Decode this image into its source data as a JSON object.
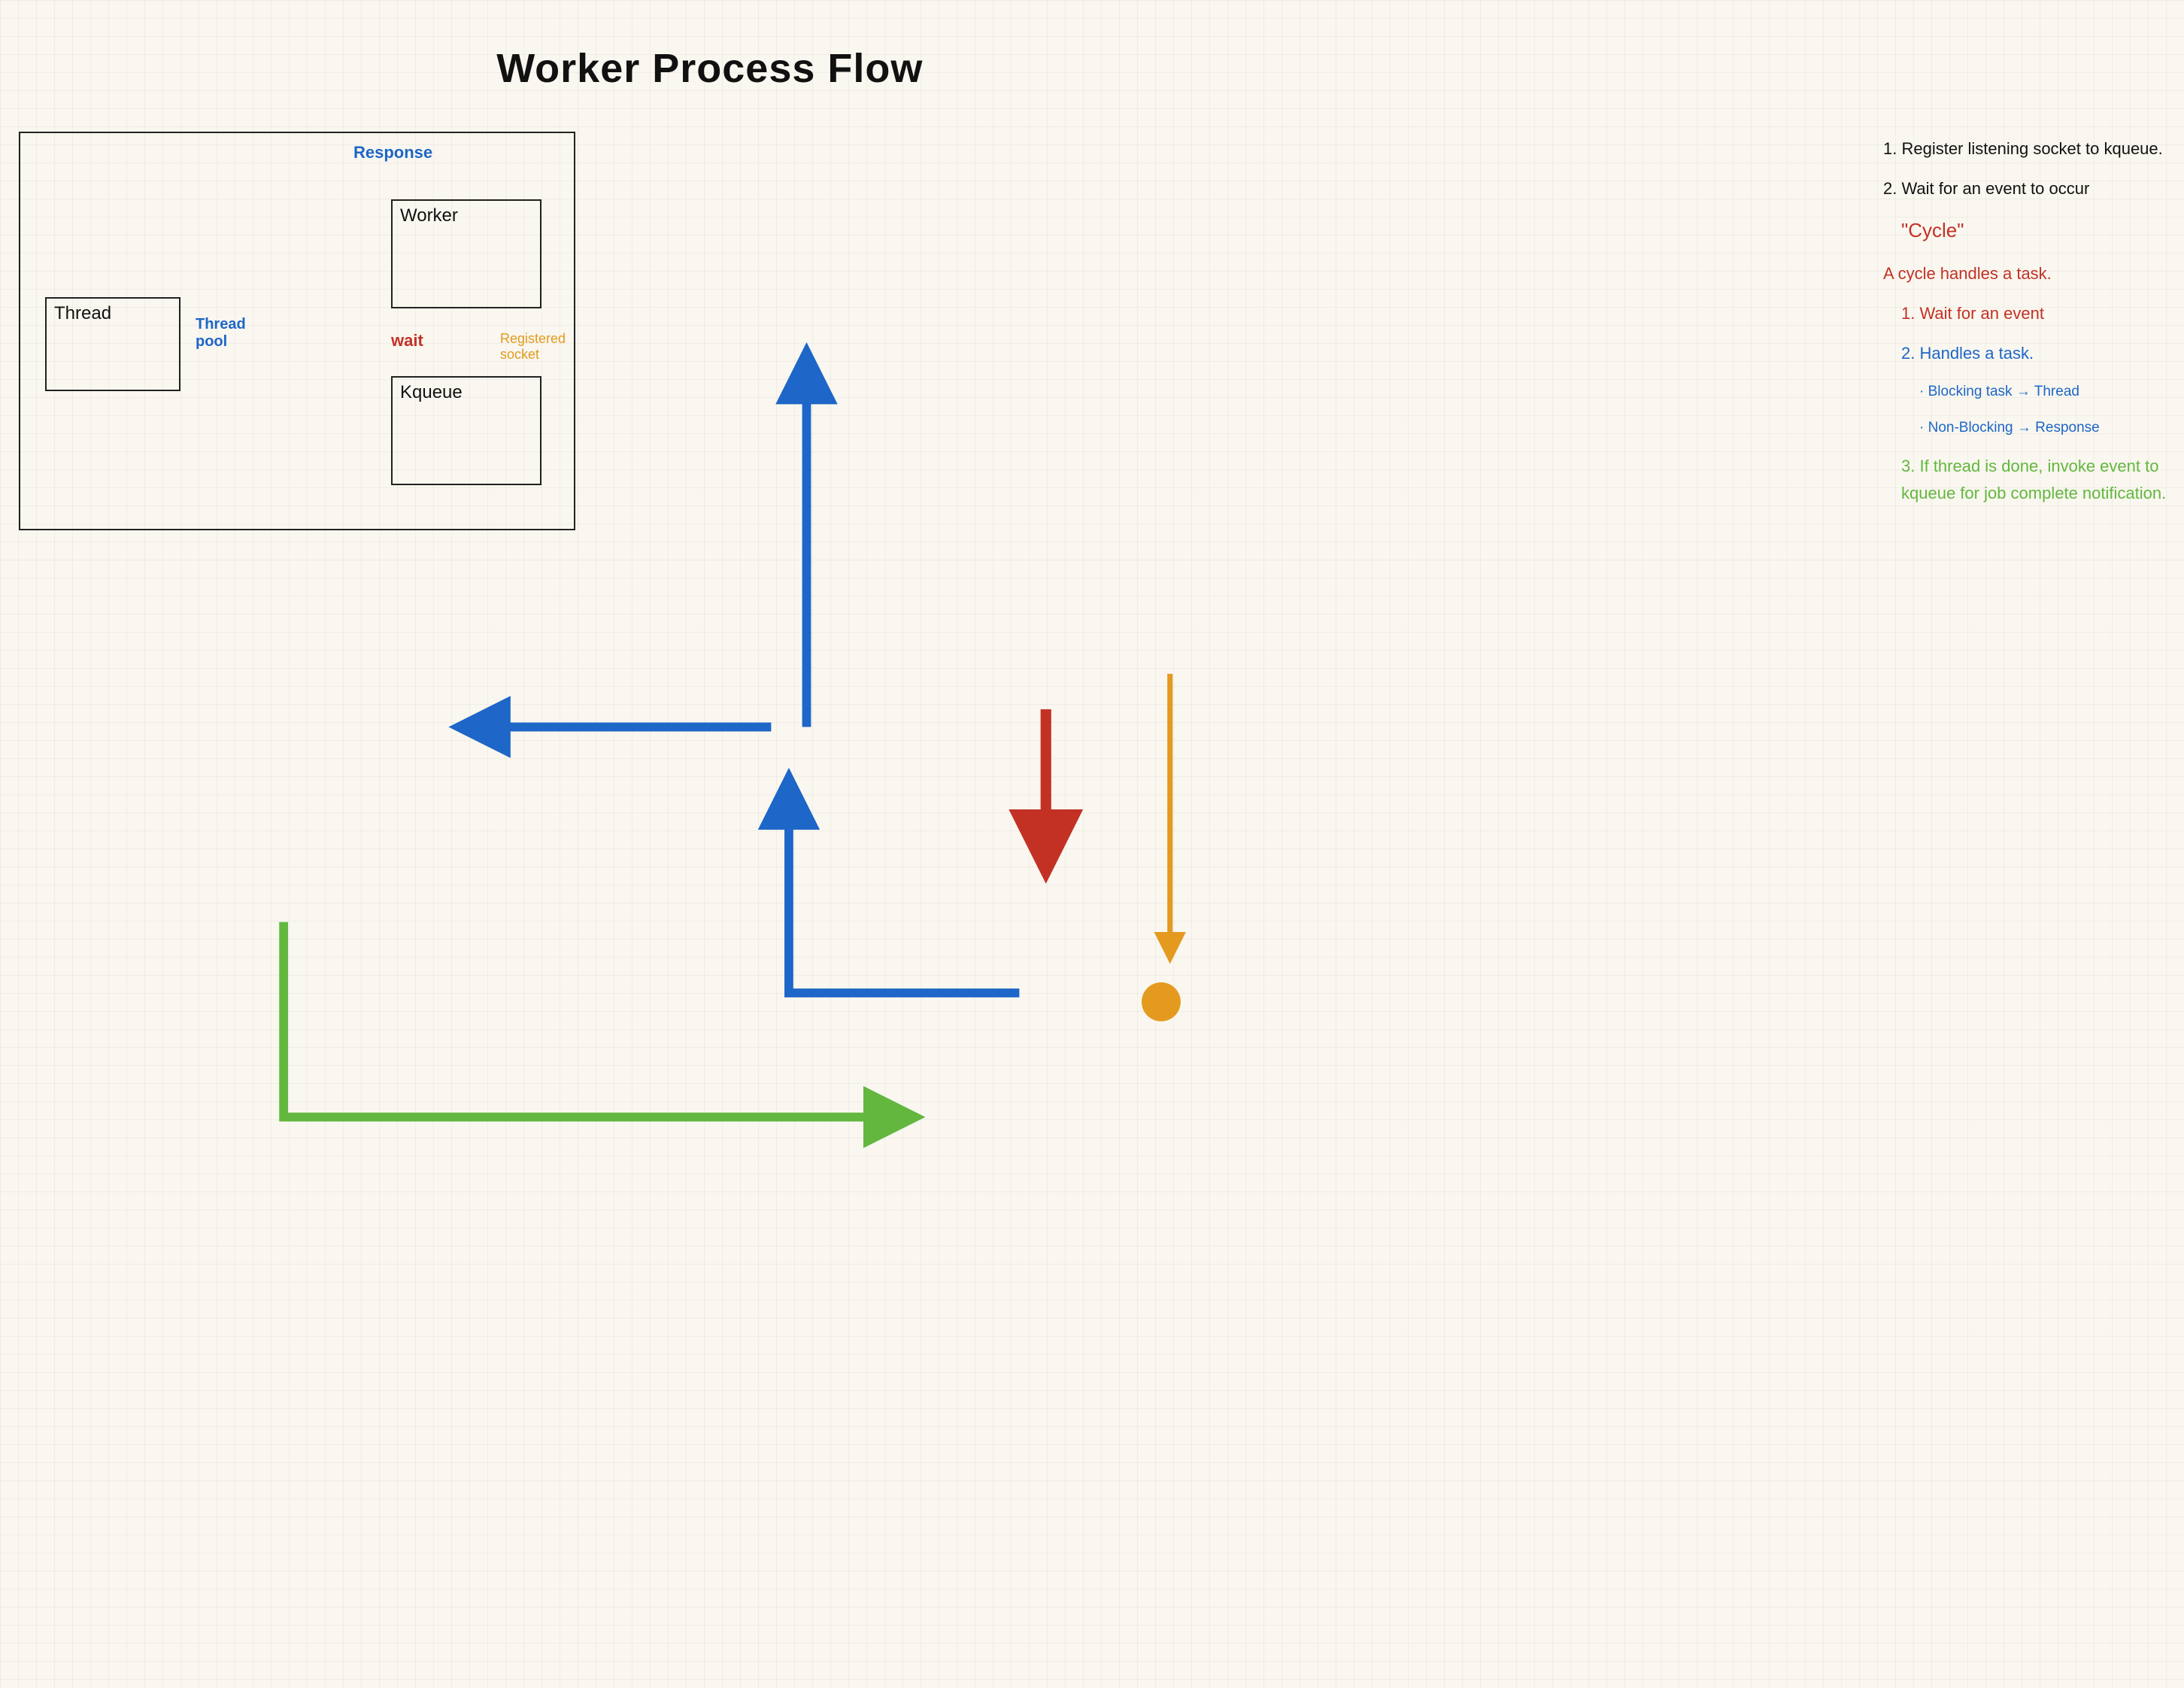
{
  "title": "Worker Process Flow",
  "boxes": {
    "thread": "Thread",
    "worker": "Worker",
    "kqueue": "Kqueue"
  },
  "diagram_labels": {
    "response": "Response",
    "thread_pool": "Thread\npool",
    "wait": "wait",
    "registered_socket": "Registered\nsocket"
  },
  "notes": {
    "n1": "1. Register listening socket to kqueue.",
    "n2": "2. Wait for an event to occur",
    "cycle": "\"Cycle\"",
    "cycle_desc": "A cycle handles a task.",
    "cycle_1": "1. Wait for an event",
    "cycle_2": "2. Handles a task.",
    "cycle_2a": "· Blocking task → Thread",
    "cycle_2b": "· Non-Blocking → Response",
    "cycle_3": "3. If thread is done, invoke event to kqueue for job complete notification."
  },
  "colors": {
    "blue": "#1e66c8",
    "red": "#c33125",
    "green": "#63b73f",
    "orange": "#e39a1f",
    "black": "#111111"
  }
}
